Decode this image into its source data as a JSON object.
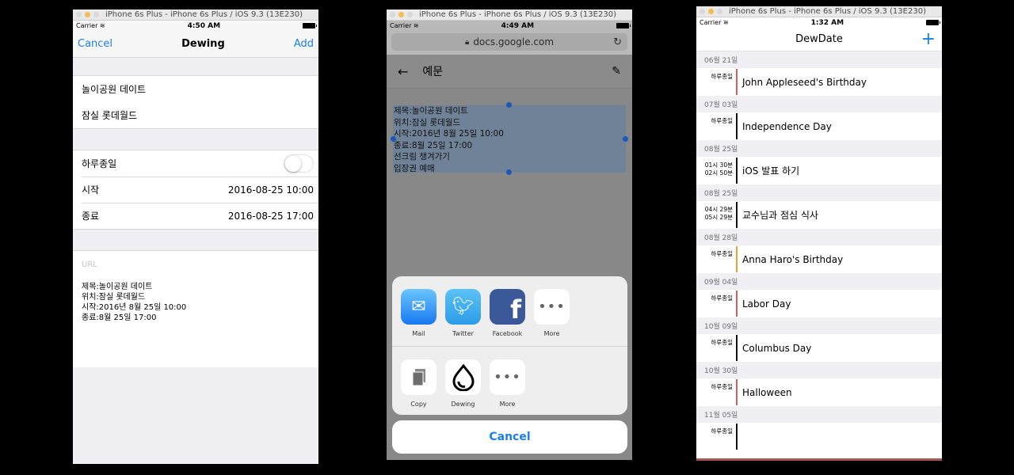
{
  "sim_title": "iPhone 6s Plus - iPhone 6s Plus / iOS 9.3 (13E230)",
  "phone1": {
    "carrier": "Carrier",
    "time": "4:50 AM",
    "nav": {
      "cancel": "Cancel",
      "title": "Dewing",
      "add": "Add"
    },
    "title_field": "놀이공원 데이트",
    "location_field": "잠실 롯데월드",
    "allday_label": "하루종일",
    "allday_on": false,
    "start_label": "시작",
    "start_value": "2016-08-25 10:00",
    "end_label": "종료",
    "end_value": "2016-08-25 17:00",
    "url_placeholder": "URL",
    "notes": "제목:놀이공원 데이트\n위치:잠실 롯데월드\n시작:2016년 8월 25일 10:00\n종료:8월 25일 17:00"
  },
  "phone2": {
    "carrier": "Carrier",
    "time": "4:49 AM",
    "address": "docs.google.com",
    "doc_title": "예문",
    "selected_text": "제목:놀이공원 데이트\n위치:잠실 롯데월드\n시작:2016년 8월 25일 10:00\n종료:8월 25일 17:00\n선크림 챙겨가기\n입장권 예매",
    "share_row": [
      {
        "label": "Mail",
        "icon": "mail-icon"
      },
      {
        "label": "Twitter",
        "icon": "twitter-icon"
      },
      {
        "label": "Facebook",
        "icon": "facebook-icon"
      },
      {
        "label": "More",
        "icon": "more-icon"
      }
    ],
    "action_row": [
      {
        "label": "Copy",
        "icon": "copy-icon"
      },
      {
        "label": "Dewing",
        "icon": "dewing-icon"
      },
      {
        "label": "More",
        "icon": "more-icon"
      }
    ],
    "cancel": "Cancel"
  },
  "phone3": {
    "carrier": "Carrier",
    "time": "1:32 AM",
    "title": "DewDate",
    "sections": [
      {
        "date": "06월 21일",
        "time": "하루종일",
        "name": "John Appleseed's Birthday",
        "color": "#e25b5b"
      },
      {
        "date": "07월 03일",
        "time": "하루종일",
        "name": "Independence Day",
        "color": "#111111"
      },
      {
        "date": "08월 25일",
        "time": "01시 30분\n02시 50분",
        "name": "iOS 발표 하기",
        "color": "#111111"
      },
      {
        "date": "08월 25일",
        "time": "04시 29분\n05시 29분",
        "name": "교수님과 점심 식사",
        "color": "#111111"
      },
      {
        "date": "08월 28일",
        "time": "하루종일",
        "name": "Anna Haro's Birthday",
        "color": "#f0a13a"
      },
      {
        "date": "09월 04일",
        "time": "하루종일",
        "name": "Labor Day",
        "color": "#e25b5b"
      },
      {
        "date": "10월 09일",
        "time": "하루종일",
        "name": "Columbus Day",
        "color": "#111111"
      },
      {
        "date": "10월 30일",
        "time": "하루종일",
        "name": "Halloween",
        "color": "#e25b5b"
      },
      {
        "date": "11월 05일",
        "time": "하루종일",
        "name": "",
        "color": "#111111"
      }
    ]
  }
}
